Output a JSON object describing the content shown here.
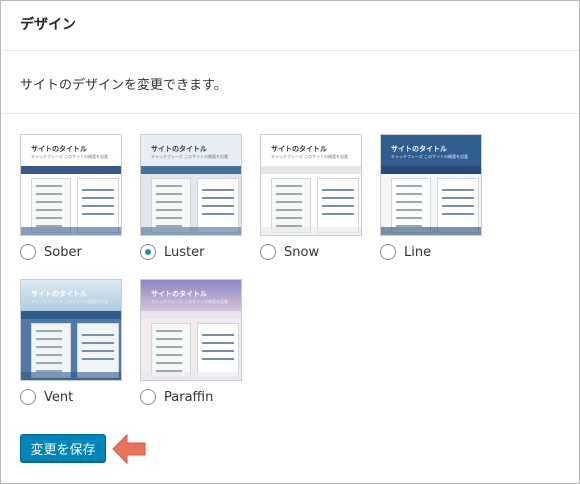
{
  "header": {
    "title": "デザイン"
  },
  "description": "サイトのデザインを変更できます。",
  "themes": [
    {
      "name": "Sober",
      "checked": false,
      "thumb_title": "サイトのタイトル",
      "thumb_sub": "キャッチフレーズ このサイトの概要を記載",
      "colors": {
        "head": "#ffffff",
        "title": "#333333",
        "nav": "#3a5a8a",
        "body": "#ffffff"
      }
    },
    {
      "name": "Luster",
      "checked": true,
      "thumb_title": "サイトのタイトル",
      "thumb_sub": "キャッチフレーズ このサイトの概要を記載",
      "colors": {
        "head": "#e8eef5",
        "title": "#333333",
        "nav": "#4a6e98",
        "body": "#dfe6ee"
      }
    },
    {
      "name": "Snow",
      "checked": false,
      "thumb_title": "サイトのタイトル",
      "thumb_sub": "キャッチフレーズ このサイトの概要を記載",
      "colors": {
        "head": "#ffffff",
        "title": "#333333",
        "nav": "#e6e6e6",
        "body": "#ffffff"
      }
    },
    {
      "name": "Line",
      "checked": false,
      "thumb_title": "サイトのタイトル",
      "thumb_sub": "キャッチフレーズ このサイトの概要を記載",
      "colors": {
        "head": "#2f5d8f",
        "title": "#ffffff",
        "nav": "#254a73",
        "body": "#f4f6f8"
      }
    },
    {
      "name": "Vent",
      "checked": false,
      "thumb_title": "サイトのタイトル",
      "thumb_sub": "キャッチフレーズ このサイトの概要を記載",
      "colors": {
        "head": "#c7d9e8",
        "title": "#ffffff",
        "nav": "#305a88",
        "body": "#4f7aa6"
      }
    },
    {
      "name": "Paraffin",
      "checked": false,
      "thumb_title": "サイトのタイトル",
      "thumb_sub": "キャッチフレーズ このサイトの概要を記載",
      "colors": {
        "head": "#9b93c8",
        "title": "#ffffff",
        "nav": "#e9e4ef",
        "body": "#f3ecef"
      }
    }
  ],
  "save_button": "変更を保存",
  "accent_color": "#0085ba",
  "arrow_color": "#e8725a"
}
